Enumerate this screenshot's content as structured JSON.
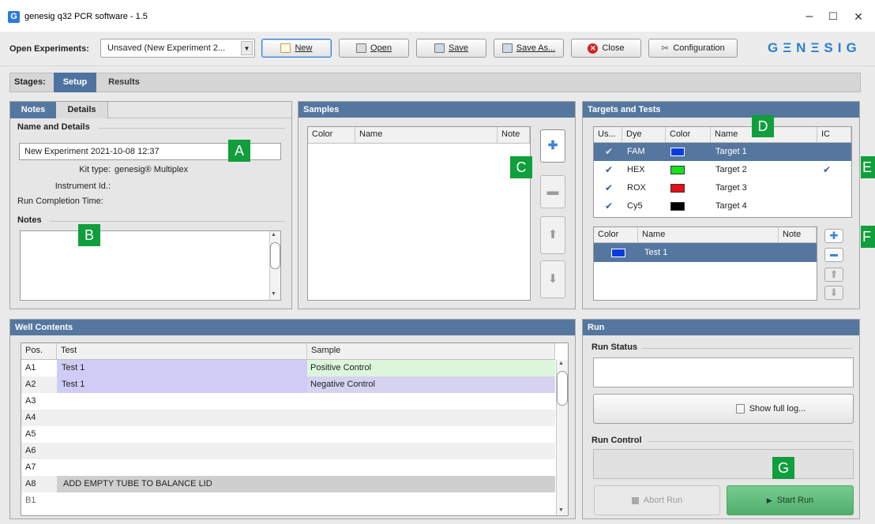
{
  "window": {
    "title": "genesig q32 PCR software - 1.5",
    "app_icon_letter": "G",
    "minimize_glyph": "–",
    "maximize_glyph": "☐",
    "close_glyph": "✕"
  },
  "toolbar": {
    "open_experiments_label": "Open Experiments:",
    "experiment_select_value": "Unsaved (New Experiment 2...",
    "new_label": "New",
    "open_label": "Open",
    "save_label": "Save",
    "save_as_label": "Save As...",
    "close_label": "Close",
    "configuration_label": "Configuration",
    "logo_text": "GΞNΞSIG"
  },
  "stages": {
    "label": "Stages:",
    "tabs": [
      "Setup",
      "Results"
    ],
    "active": "Setup"
  },
  "notes_panel": {
    "tabs": [
      "Notes",
      "Details"
    ],
    "name_and_details_heading": "Name and Details",
    "experiment_name_value": "New Experiment 2021-10-08 12:37",
    "kit_type_label": "Kit type:",
    "kit_type_value": "genesig® Multiplex",
    "instrument_id_label": "Instrument Id.:",
    "run_completion_label": "Run Completion Time:",
    "notes_heading": "Notes",
    "notes_value": ""
  },
  "samples_panel": {
    "title": "Samples",
    "columns": [
      "Color",
      "Name",
      "Note"
    ],
    "rows": []
  },
  "targets_panel": {
    "title": "Targets and Tests",
    "target_columns": [
      "Us...",
      "Dye",
      "Color",
      "Name",
      "IC"
    ],
    "targets": [
      {
        "dye": "FAM",
        "color": "#0b3be0",
        "name": "Target 1",
        "used": true,
        "ic": false,
        "selected": true
      },
      {
        "dye": "HEX",
        "color": "#16e01f",
        "name": "Target 2",
        "used": true,
        "ic": true,
        "selected": false
      },
      {
        "dye": "ROX",
        "color": "#e3121a",
        "name": "Target 3",
        "used": true,
        "ic": false,
        "selected": false
      },
      {
        "dye": "Cy5",
        "color": "#000000",
        "name": "Target 4",
        "used": true,
        "ic": false,
        "selected": false
      }
    ],
    "test_columns": [
      "Color",
      "Name",
      "Note"
    ],
    "tests": [
      {
        "color": "#0b3be0",
        "name": "Test 1",
        "note": "",
        "selected": true
      }
    ],
    "check_glyph": "✔"
  },
  "well_panel": {
    "title": "Well Contents",
    "columns": [
      "Pos.",
      "Test",
      "Sample"
    ],
    "rows": [
      {
        "pos": "A1",
        "test": "Test 1",
        "sample": "Positive Control"
      },
      {
        "pos": "A2",
        "test": "Test 1",
        "sample": "Negative Control"
      },
      {
        "pos": "A3",
        "test": "",
        "sample": ""
      },
      {
        "pos": "A4",
        "test": "",
        "sample": ""
      },
      {
        "pos": "A5",
        "test": "",
        "sample": ""
      },
      {
        "pos": "A6",
        "test": "",
        "sample": ""
      },
      {
        "pos": "A7",
        "test": "",
        "sample": ""
      },
      {
        "pos": "A8",
        "test": "ADD EMPTY TUBE TO BALANCE LID",
        "sample": ""
      },
      {
        "pos": "B1",
        "test": "",
        "sample": ""
      }
    ]
  },
  "run_panel": {
    "title": "Run",
    "run_status_heading": "Run Status",
    "run_status_value": "",
    "show_full_log_label": "Show full log...",
    "run_control_heading": "Run Control",
    "abort_run_label": "Abort Run",
    "start_run_label": "Start Run"
  },
  "callouts": [
    "A",
    "B",
    "C",
    "D",
    "E",
    "F",
    "G"
  ],
  "colors": {
    "panel_header": "#55779f",
    "selected_row": "#55779f",
    "test_cell_bg": "#cfcdf5",
    "positive_control_bg": "#dcf6dc",
    "negative_control_bg": "#d6d3f2",
    "callout_green": "#119e3c",
    "start_run_green": "#5fbf7b"
  }
}
